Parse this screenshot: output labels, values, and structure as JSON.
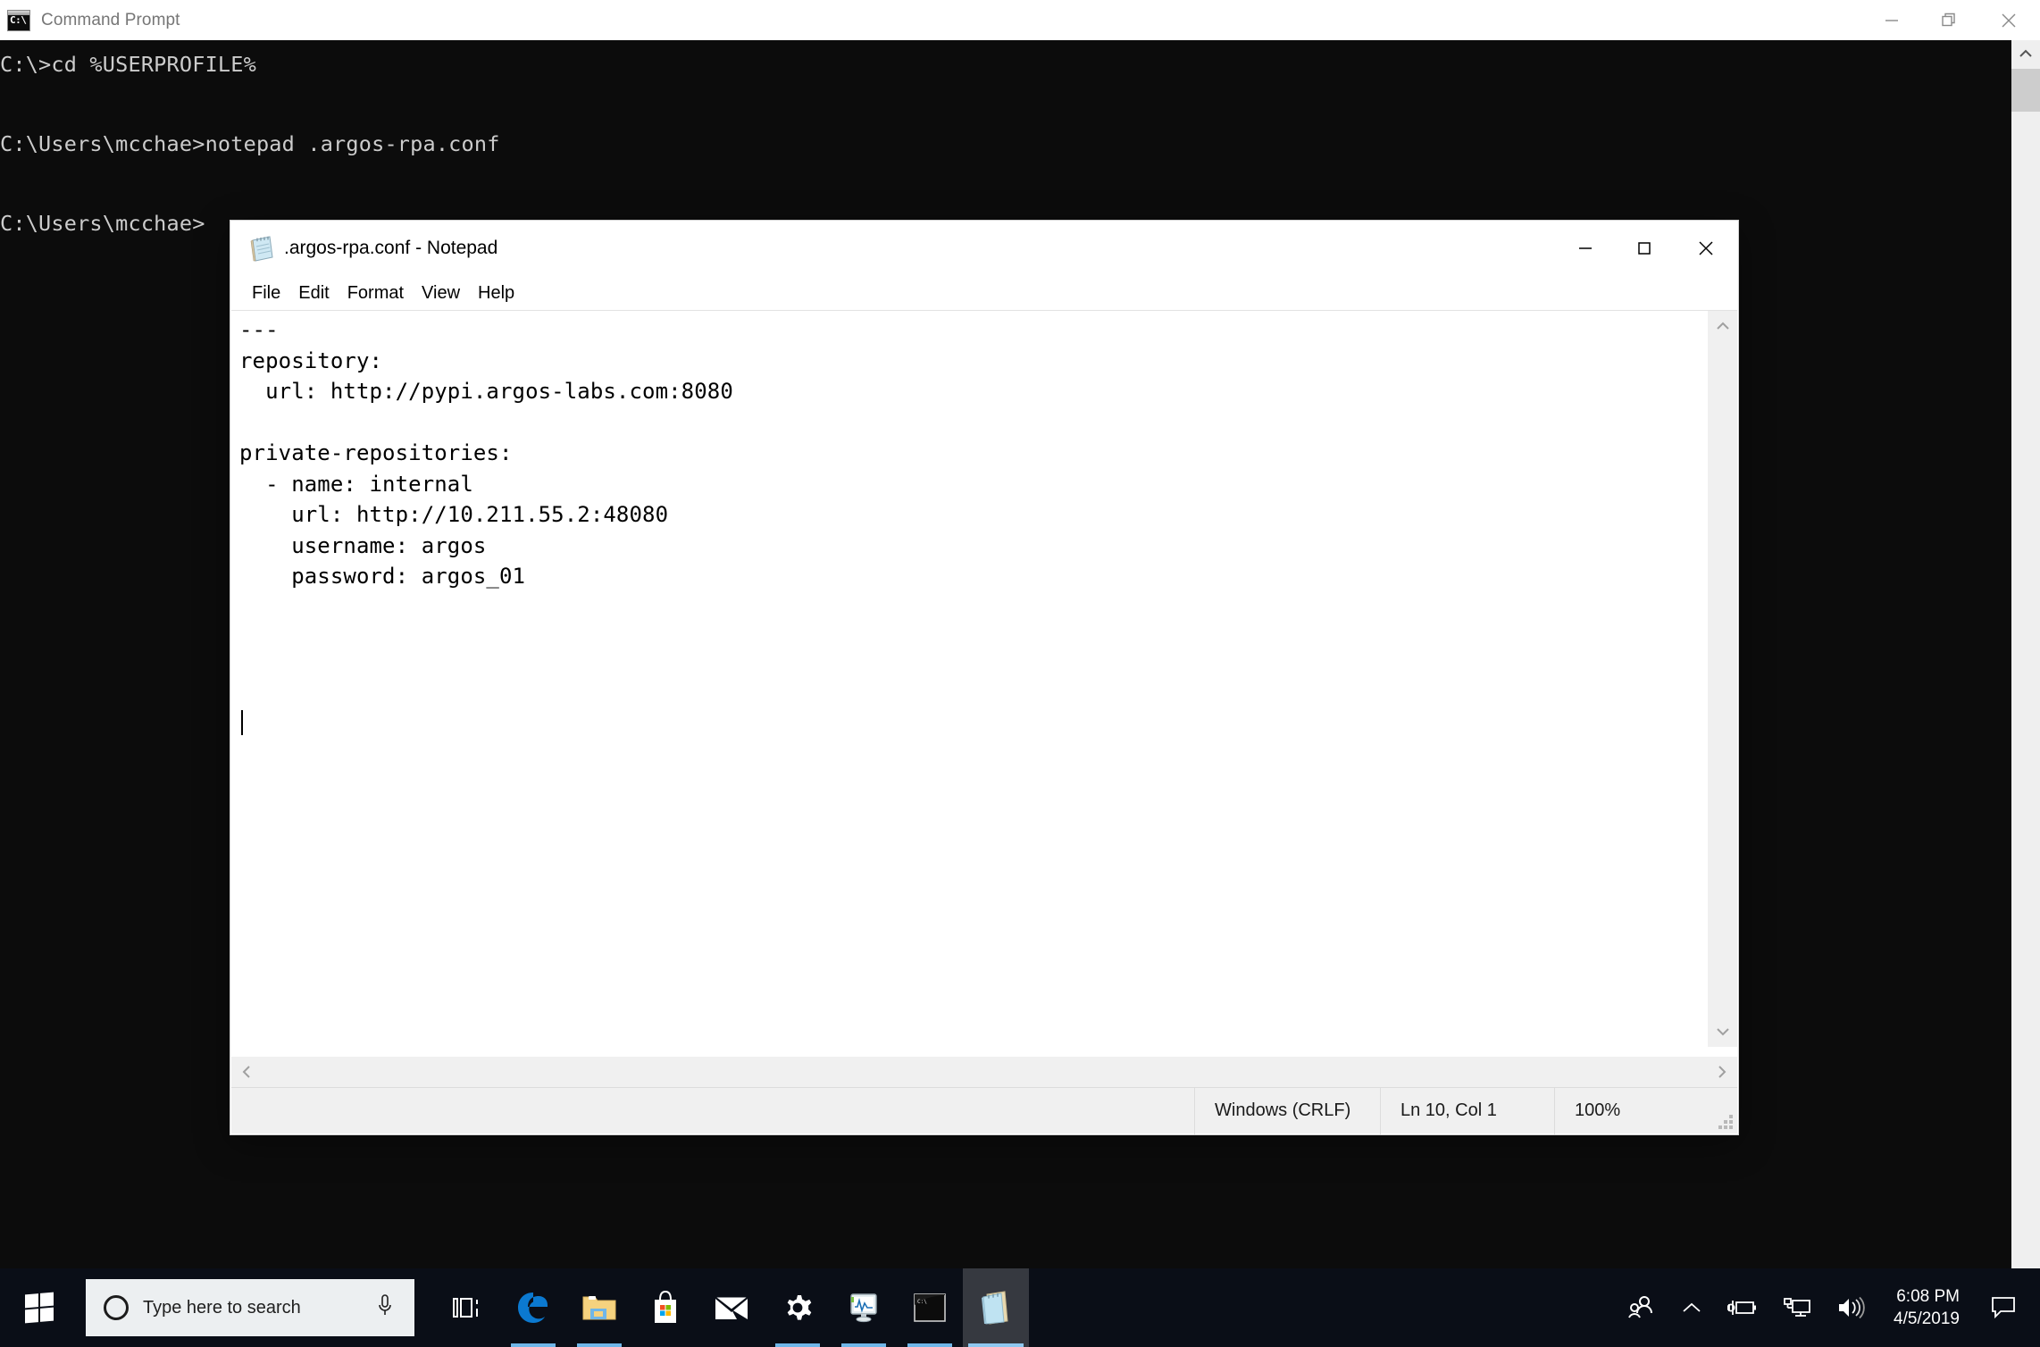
{
  "cmd_window": {
    "title": "Command Prompt",
    "icon": "command-prompt-icon",
    "icon_glyph": "C:\\",
    "controls": {
      "minimize": "—",
      "restore": "restore-icon",
      "close": "✕"
    },
    "console_text": "C:\\>cd %USERPROFILE%\n\nC:\\Users\\mcchae>notepad .argos-rpa.conf\n\nC:\\Users\\mcchae>",
    "lines": [
      "C:\\>cd %USERPROFILE%",
      "",
      "C:\\Users\\mcchae>notepad .argos-rpa.conf",
      "",
      "C:\\Users\\mcchae>"
    ],
    "background": "#0c0c0c",
    "foreground": "#cccccc"
  },
  "notepad_window": {
    "title": ".argos-rpa.conf - Notepad",
    "filename": ".argos-rpa.conf",
    "icon": "notepad-icon",
    "controls": {
      "minimize": "—",
      "maximize": "☐",
      "close": "✕"
    },
    "menu": [
      {
        "label": "File"
      },
      {
        "label": "Edit"
      },
      {
        "label": "Format"
      },
      {
        "label": "View"
      },
      {
        "label": "Help"
      }
    ],
    "document_text": "---\nrepository:\n  url: http://pypi.argos-labs.com:8080\n\nprivate-repositories:\n  - name: internal\n    url: http://10.211.55.2:48080\n    username: argos\n    password: argos_01\n",
    "document_lines": [
      "---",
      "repository:",
      "  url: http://pypi.argos-labs.com:8080",
      "",
      "private-repositories:",
      "  - name: internal",
      "    url: http://10.211.55.2:48080",
      "    username: argos",
      "    password: argos_01",
      ""
    ],
    "status_bar": {
      "line_ending": "Windows (CRLF)",
      "cursor_position": "Ln 10, Col 1",
      "zoom": "100%"
    }
  },
  "taskbar": {
    "start": "windows-start-icon",
    "search": {
      "placeholder": "Type here to search",
      "cortana_icon": "cortana-circle-icon",
      "mic_icon": "microphone-icon"
    },
    "apps": [
      {
        "name": "task-view",
        "label": "Task View",
        "state": "idle"
      },
      {
        "name": "microsoft-edge",
        "label": "Microsoft Edge",
        "state": "running"
      },
      {
        "name": "file-explorer",
        "label": "File Explorer",
        "state": "running"
      },
      {
        "name": "microsoft-store",
        "label": "Microsoft Store",
        "state": "idle"
      },
      {
        "name": "mail",
        "label": "Mail",
        "state": "idle"
      },
      {
        "name": "settings",
        "label": "Settings",
        "state": "running"
      },
      {
        "name": "task-manager",
        "label": "Task Manager",
        "state": "running"
      },
      {
        "name": "command-prompt",
        "label": "Command Prompt",
        "state": "running"
      },
      {
        "name": "notepad",
        "label": "Notepad",
        "state": "active"
      }
    ],
    "tray": {
      "people_icon": "people-icon",
      "show_hidden_icon": "chevron-up-icon",
      "battery_icon": "battery-charging-icon",
      "network_icon": "network-icon",
      "volume_icon": "volume-icon",
      "time": "6:08 PM",
      "date": "4/5/2019",
      "action_center_icon": "action-center-icon"
    }
  },
  "colors": {
    "console_bg": "#0c0c0c",
    "console_fg": "#cccccc",
    "taskbar_bg": "#0a0e17",
    "accent": "#6fb6e8",
    "window_bg": "#ffffff"
  }
}
